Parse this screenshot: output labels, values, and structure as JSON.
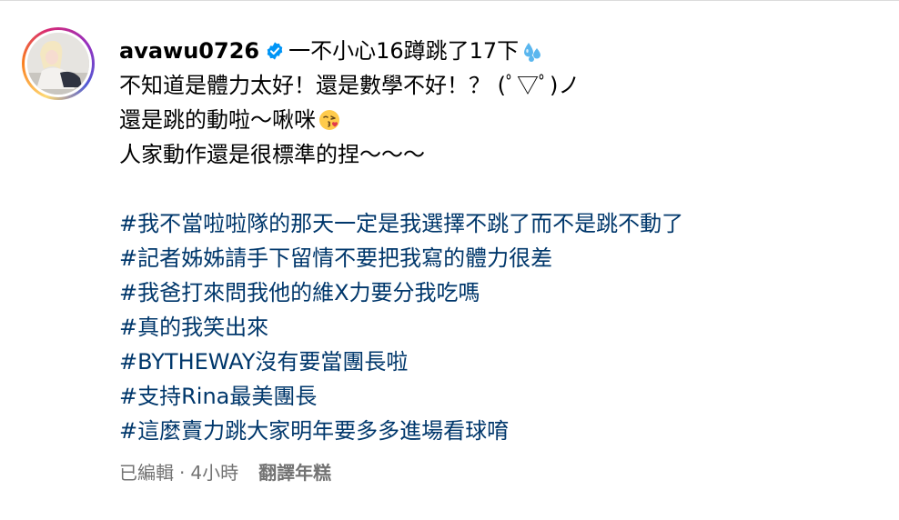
{
  "post": {
    "username": "avawu0726",
    "first_line_text": "一不小心16蹲跳了17下",
    "lines": [
      "不知道是體力太好！還是數學不好！？ (ﾟ▽ﾟ)ノ",
      "還是跳的動啦～啾咪",
      "人家動作還是很標準的捏～～～"
    ],
    "hashtags": [
      "#我不當啦啦隊的那天一定是我選擇不跳了而不是跳不動了",
      "#記者姊姊請手下留情不要把我寫的體力很差",
      "#我爸打來問我他的維X力要分我吃嗎",
      "#真的我笑出來",
      "#BYTHEWAY沒有要當團長啦",
      "#支持Rina最美團長",
      "#這麼賣力跳大家明年要多多進場看球唷"
    ],
    "meta": {
      "edited": "已編輯",
      "separator": "·",
      "time": "4小時",
      "translate": "翻譯年糕"
    }
  },
  "icons": {
    "verified": "verified-badge-icon",
    "sweat": "sweat-droplets-emoji",
    "kiss": "kissing-face-emoji"
  },
  "colors": {
    "hashtag": "#00376b",
    "verified": "#0095f6",
    "meta": "#737373"
  }
}
